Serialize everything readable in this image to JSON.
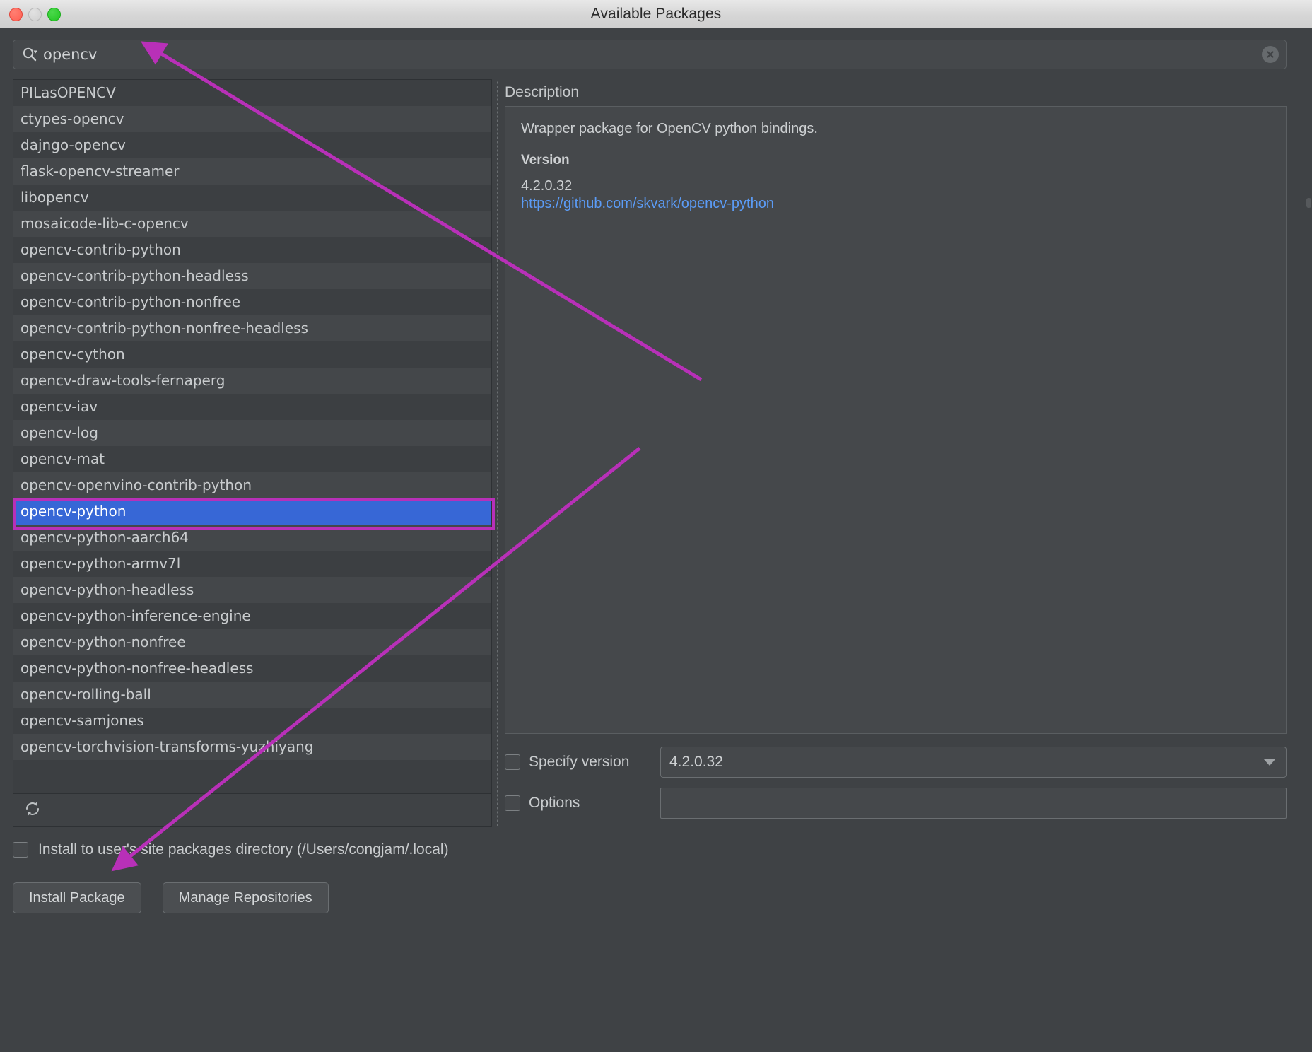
{
  "window": {
    "title": "Available Packages",
    "traffic_lights": [
      "close-red",
      "minimize-yellow",
      "zoom-green"
    ]
  },
  "search": {
    "value": "opencv",
    "placeholder": "",
    "icon": "search-icon",
    "clear_icon": "clear-circle-icon"
  },
  "package_list": {
    "items": [
      "PILasOPENCV",
      "ctypes-opencv",
      "dajngo-opencv",
      "flask-opencv-streamer",
      "libopencv",
      "mosaicode-lib-c-opencv",
      "opencv-contrib-python",
      "opencv-contrib-python-headless",
      "opencv-contrib-python-nonfree",
      "opencv-contrib-python-nonfree-headless",
      "opencv-cython",
      "opencv-draw-tools-fernaperg",
      "opencv-iav",
      "opencv-log",
      "opencv-mat",
      "opencv-openvino-contrib-python",
      "opencv-python",
      "opencv-python-aarch64",
      "opencv-python-armv7l",
      "opencv-python-headless",
      "opencv-python-inference-engine",
      "opencv-python-nonfree",
      "opencv-python-nonfree-headless",
      "opencv-rolling-ball",
      "opencv-samjones",
      "opencv-torchvision-transforms-yuzhiyang"
    ],
    "selected_index": 16,
    "refresh_icon": "refresh-icon"
  },
  "description": {
    "section_title": "Description",
    "summary": "Wrapper package for OpenCV python bindings.",
    "version_heading": "Version",
    "version_value": "4.2.0.32",
    "homepage_url": "https://github.com/skvark/opencv-python"
  },
  "options": {
    "specify_version_label": "Specify version",
    "specify_version_checked": false,
    "specify_version_value": "4.2.0.32",
    "options_label": "Options",
    "options_checked": false,
    "options_value": "",
    "dropdown_icon": "chevron-down-icon"
  },
  "install": {
    "user_site_label": "Install to user's site packages directory (/Users/congjam/.local)",
    "user_site_checked": false,
    "install_button": "Install Package",
    "manage_button": "Manage Repositories"
  },
  "colors": {
    "selection_blue": "#3767d6",
    "annotation_magenta": "#b830b8",
    "link_blue": "#5b9bf5",
    "window_bg": "#3f4245",
    "list_row_odd": "#3c3f42",
    "list_row_even": "#44474a"
  }
}
